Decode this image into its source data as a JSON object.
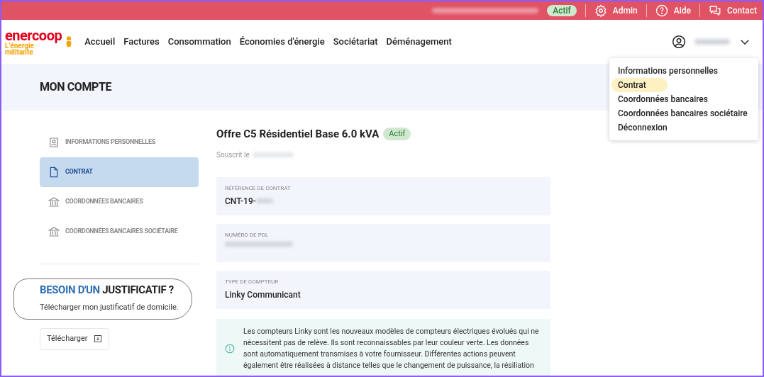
{
  "top_bar": {
    "status_badge": "Actif",
    "links": [
      {
        "kind": "admin",
        "label": "Admin"
      },
      {
        "kind": "help",
        "label": "Aide"
      },
      {
        "kind": "contact",
        "label": "Contact"
      }
    ]
  },
  "header": {
    "logo": {
      "name": "enercoop",
      "tagline_1": "L’énergie",
      "tagline_2": "militante"
    },
    "nav": [
      "Accueil",
      "Factures",
      "Consommation",
      "Économies d'énergie",
      "Sociétariat",
      "Déménagement"
    ]
  },
  "user_menu": {
    "items": [
      {
        "label": "Informations personnelles",
        "selected": false
      },
      {
        "label": "Contrat",
        "selected": true
      },
      {
        "label": "Coordonnées bancaires",
        "selected": false
      },
      {
        "label": "Coordonnées bancaires sociétaire",
        "selected": false
      },
      {
        "label": "Déconnexion",
        "selected": false
      }
    ]
  },
  "page_title": "MON COMPTE",
  "sidebar": {
    "items": [
      {
        "kind": "person",
        "label": "INFORMATIONS PERSONNELLES",
        "selected": false
      },
      {
        "kind": "document",
        "label": "CONTRAT",
        "selected": true
      },
      {
        "kind": "bank",
        "label": "COORDONNÉES BANCAIRES",
        "selected": false
      },
      {
        "kind": "bank",
        "label": "COORDONNÉES BANCAIRES SOCIÉTAIRE",
        "selected": false
      }
    ],
    "proof": {
      "heading_lead": "BESOIN D'UN",
      "heading_rest": "JUSTIFICATIF ?",
      "text": "Télécharger mon justificatif de domicile.",
      "button": "Télécharger"
    }
  },
  "contract": {
    "title": "Offre C5 Résidentiel Base 6.0 kVA",
    "status": "Actif",
    "subscribed_label": "Souscrit le",
    "fields": [
      {
        "label": "RÉFÉRENCE DE CONTRAT",
        "value": "CNT-19-"
      },
      {
        "label": "NUMÉRO DE PDL"
      },
      {
        "label": "TYPE DE COMPTEUR",
        "value": "Linky Communicant"
      }
    ],
    "info": "Les compteurs Linky sont les nouveaux modèles de compteurs électriques évolués qui ne nécessitent pas de relève. Ils sont reconnaissables par leur couleur verte. Les données sont automatiquement transmises à votre fournisseur. Différentes actions peuvent également être réalisées à distance telles que le changement de puissance, la résiliation"
  }
}
